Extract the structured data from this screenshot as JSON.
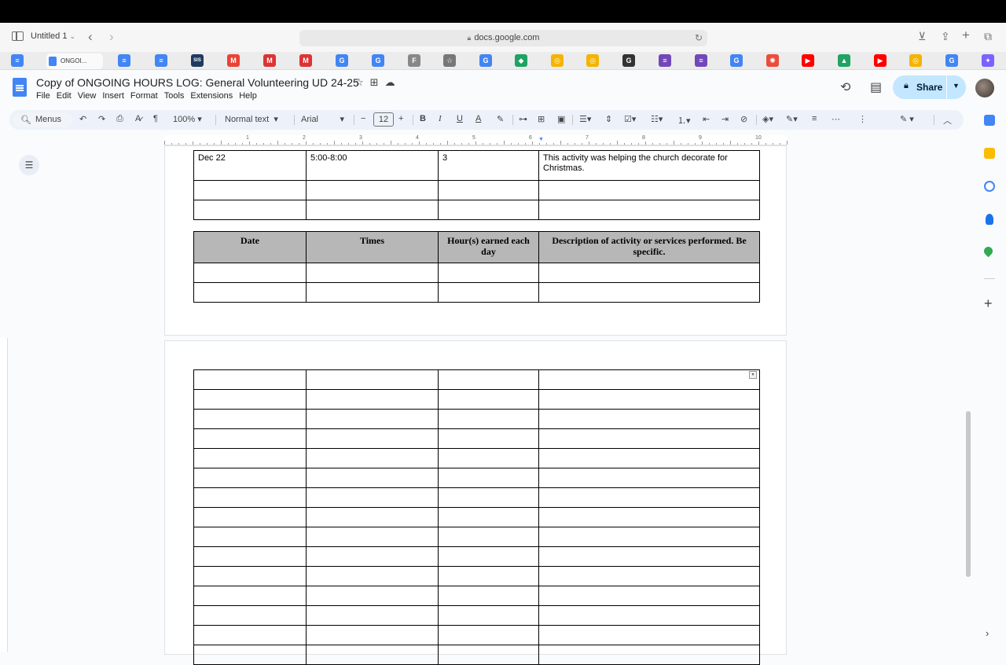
{
  "safari": {
    "tab_group_title": "Untitled 1",
    "url": "docs.google.com",
    "active_tab_label": "ONGOI..."
  },
  "bookmarks": [
    {
      "name": "docs",
      "color": "#4285f4",
      "glyph": "≡"
    },
    {
      "name": "docs",
      "color": "#4285f4",
      "glyph": "≡"
    },
    {
      "name": "docs",
      "color": "#4285f4",
      "glyph": "≡"
    },
    {
      "name": "sis",
      "color": "#1f3a60",
      "glyph": "SIS"
    },
    {
      "name": "gmail",
      "color": "#ea4335",
      "glyph": "M"
    },
    {
      "name": "mail",
      "color": "#d33",
      "glyph": "M"
    },
    {
      "name": "mail",
      "color": "#d33",
      "glyph": "M"
    },
    {
      "name": "google",
      "color": "#4285f4",
      "glyph": "G"
    },
    {
      "name": "google",
      "color": "#4285f4",
      "glyph": "G"
    },
    {
      "name": "f",
      "color": "#888",
      "glyph": "F"
    },
    {
      "name": "star",
      "color": "#777",
      "glyph": "☆"
    },
    {
      "name": "google",
      "color": "#4285f4",
      "glyph": "G"
    },
    {
      "name": "green",
      "color": "#1ea362",
      "glyph": "◆"
    },
    {
      "name": "chrome",
      "color": "#f4b400",
      "glyph": "◎"
    },
    {
      "name": "chrome",
      "color": "#f4b400",
      "glyph": "◎"
    },
    {
      "name": "grammarly",
      "color": "#333",
      "glyph": "G"
    },
    {
      "name": "forms",
      "color": "#7248b9",
      "glyph": "≡"
    },
    {
      "name": "forms",
      "color": "#7248b9",
      "glyph": "≡"
    },
    {
      "name": "google",
      "color": "#4285f4",
      "glyph": "G"
    },
    {
      "name": "red-circle",
      "color": "#e94e3c",
      "glyph": "✺"
    },
    {
      "name": "youtube",
      "color": "#ff0000",
      "glyph": "▶"
    },
    {
      "name": "drive",
      "color": "#1fa463",
      "glyph": "▲"
    },
    {
      "name": "youtube",
      "color": "#ff0000",
      "glyph": "▶"
    },
    {
      "name": "chrome",
      "color": "#f4b400",
      "glyph": "◎"
    },
    {
      "name": "google",
      "color": "#4285f4",
      "glyph": "G"
    },
    {
      "name": "gemini",
      "color": "#7b61ff",
      "glyph": "✦"
    }
  ],
  "doc": {
    "title": "Copy of ONGOING HOURS LOG: General Volunteering UD 24-25",
    "menu": [
      "File",
      "Edit",
      "View",
      "Insert",
      "Format",
      "Tools",
      "Extensions",
      "Help"
    ],
    "share_label": "Share"
  },
  "toolbar": {
    "menus_label": "Menus",
    "zoom": "100%",
    "style": "Normal text",
    "font": "Arial",
    "font_size": "12"
  },
  "ruler_numbers": [
    "1",
    "2",
    "3",
    "4",
    "5",
    "6",
    "7",
    "8",
    "9",
    "10"
  ],
  "table_top": {
    "row1": [
      "Dec 22",
      "5:00-8:00",
      "3",
      "This activity was helping the church decorate for Christmas."
    ]
  },
  "table_header": [
    "Date",
    "Times",
    "Hour(s) earned each day",
    "Description of activity or services performed. Be specific."
  ],
  "page2_rows": 15
}
